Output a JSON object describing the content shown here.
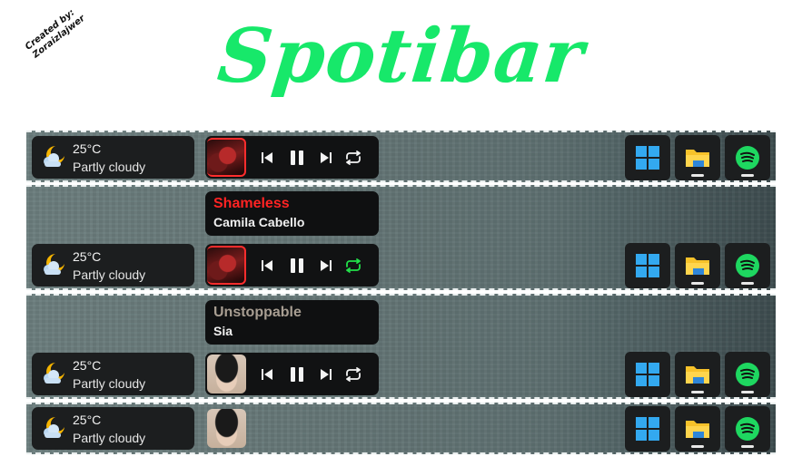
{
  "credit": {
    "line1": "Created by:",
    "line2": "Zoraizlajwer"
  },
  "app": {
    "title": "Spotibar"
  },
  "weather": {
    "temp": "25°C",
    "condition": "Partly cloudy",
    "icon": "partly-cloudy-night-icon"
  },
  "bars": [
    {
      "song_card": null,
      "album_art": "camila-album-art",
      "controls": true,
      "repeat_active": false
    },
    {
      "song_card": {
        "song": "Shameless",
        "artist": "Camila Cabello",
        "song_color": "#ff2323"
      },
      "album_art": "camila-album-art",
      "controls": true,
      "repeat_active": true
    },
    {
      "song_card": {
        "song": "Unstoppable",
        "artist": "Sia",
        "song_color": "#a89e92"
      },
      "album_art": "sia-album-art",
      "controls": true,
      "repeat_active": false
    },
    {
      "song_card": null,
      "album_art": "sia-album-art",
      "controls": false,
      "repeat_active": false
    }
  ],
  "taskbar_apps": [
    {
      "name": "windows-start",
      "icon": "windows-logo-icon"
    },
    {
      "name": "file-explorer",
      "icon": "folder-icon"
    },
    {
      "name": "spotify",
      "icon": "spotify-icon"
    }
  ],
  "colors": {
    "accent_green": "#17e86a",
    "spotify_green": "#1ed760",
    "repeat_active": "#22e04a",
    "widget_bg": "#1c1e1f"
  }
}
